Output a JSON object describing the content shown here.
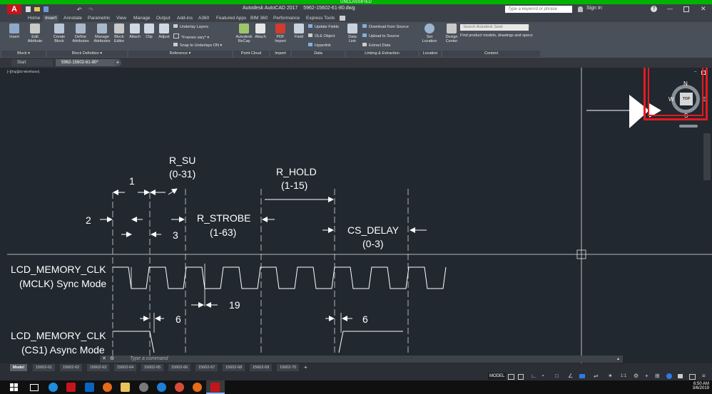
{
  "classification": "UNCLASSIFIED",
  "app": {
    "logo": "A",
    "title": "Autodesk AutoCAD 2017",
    "filename": "5962-15602-61-80.dwg",
    "search_placeholder": "Type a keyword or phrase",
    "sign_in": "Sign In"
  },
  "ribbon_tabs": [
    "Home",
    "Insert",
    "Annotate",
    "Parametric",
    "View",
    "Manage",
    "Output",
    "Add-ins",
    "A360",
    "Featured Apps",
    "BIM 360",
    "Performance",
    "Express Tools"
  ],
  "ribbon": {
    "insert": "Insert",
    "edit_attribute": "Edit Attribute",
    "create_block": "Create Block",
    "define_attributes": "Define Attributes",
    "manage_attributes": "Manage Attributes",
    "block_editor": "Block Editor",
    "attach": "Attach",
    "clip": "Clip",
    "adjust": "Adjust",
    "underlay_layers": "Underlay Layers",
    "frames_vary": "*Frames vary*",
    "snap_to_underlays": "Snap to Underlays ON",
    "recap": "Autodesk ReCap",
    "attach2": "Attach",
    "pdf_import": "PDF Import",
    "field": "Field",
    "update_fields": "Update Fields",
    "ole_object": "OLE Object",
    "hyperlink": "Hyperlink",
    "data_link": "Data Link",
    "download_from_source": "Download from Source",
    "upload_to_source": "Upload to Source",
    "extract_data": "Extract  Data",
    "set_location": "Set Location",
    "design_center": "Design Center",
    "seek_placeholder": "Search Autodesk Seek",
    "seek_text": "Find product models, drawings and specs"
  },
  "ribbon_groups": {
    "block": "Block",
    "block_definition": "Block Definition",
    "reference": "Reference",
    "point_cloud": "Point Cloud",
    "import": "Import",
    "data": "Data",
    "linking": "Linking & Extraction",
    "location": "Location",
    "content": "Content"
  },
  "file_tabs": [
    "Start",
    "5962-15602-61-80*"
  ],
  "viewport_label": "[–][Top][2D Wireframe]",
  "viewcube": {
    "n": "N",
    "s": "S",
    "e": "E",
    "w": "W",
    "face": "TOP"
  },
  "drawing": {
    "r_su": "R_SU",
    "r_su_range": "(0-31)",
    "r_hold": "R_HOLD",
    "r_hold_range": "(1-15)",
    "r_strobe": "R_STROBE",
    "r_strobe_range": "(1-63)",
    "cs_delay": "CS_DELAY",
    "cs_delay_range": "(0-3)",
    "n1": "1",
    "n2": "2",
    "n3": "3",
    "n19": "19",
    "n6a": "6",
    "n6b": "6",
    "sig1_line1": "LCD_MEMORY_CLK",
    "sig1_line2": "(MCLK) Sync Mode",
    "sig2_line1": "LCD_MEMORY_CLK",
    "sig2_line2": "(CS1) Async Mode"
  },
  "command_placeholder": "Type a command",
  "layout_tabs": [
    "Model",
    "15602-61",
    "15602-62",
    "15602-63",
    "15602-64",
    "15602-65",
    "15602-66",
    "15602-67",
    "15602-68",
    "15602-69",
    "15602-70"
  ],
  "status": {
    "model": "MODEL",
    "scale": "1:1"
  },
  "clock": {
    "time": "6:50 AM",
    "date": "3/6/2019"
  },
  "colors": {
    "highlight_box": "#e8191f",
    "classification_bar": "#00b300",
    "canvas": "#212830"
  }
}
